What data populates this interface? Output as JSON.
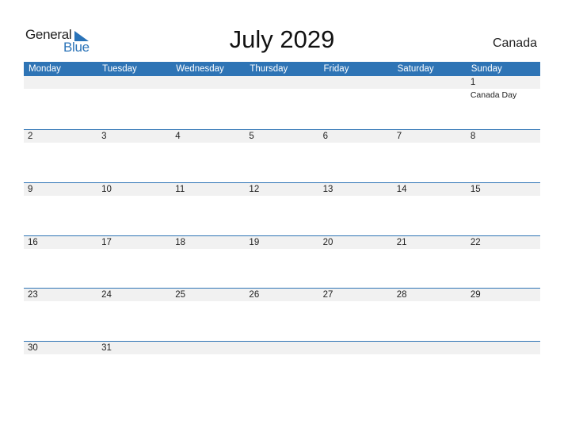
{
  "logo": {
    "general": "General",
    "blue": "Blue",
    "accent": "#2a73b8"
  },
  "title": "July 2029",
  "country": "Canada",
  "header_color": "#2e74b5",
  "weekdays": [
    "Monday",
    "Tuesday",
    "Wednesday",
    "Thursday",
    "Friday",
    "Saturday",
    "Sunday"
  ],
  "weeks": [
    {
      "days": [
        {
          "num": "",
          "event": ""
        },
        {
          "num": "",
          "event": ""
        },
        {
          "num": "",
          "event": ""
        },
        {
          "num": "",
          "event": ""
        },
        {
          "num": "",
          "event": ""
        },
        {
          "num": "",
          "event": ""
        },
        {
          "num": "1",
          "event": "Canada Day"
        }
      ]
    },
    {
      "days": [
        {
          "num": "2"
        },
        {
          "num": "3"
        },
        {
          "num": "4"
        },
        {
          "num": "5"
        },
        {
          "num": "6"
        },
        {
          "num": "7"
        },
        {
          "num": "8"
        }
      ]
    },
    {
      "days": [
        {
          "num": "9"
        },
        {
          "num": "10"
        },
        {
          "num": "11"
        },
        {
          "num": "12"
        },
        {
          "num": "13"
        },
        {
          "num": "14"
        },
        {
          "num": "15"
        }
      ]
    },
    {
      "days": [
        {
          "num": "16"
        },
        {
          "num": "17"
        },
        {
          "num": "18"
        },
        {
          "num": "19"
        },
        {
          "num": "20"
        },
        {
          "num": "21"
        },
        {
          "num": "22"
        }
      ]
    },
    {
      "days": [
        {
          "num": "23"
        },
        {
          "num": "24"
        },
        {
          "num": "25"
        },
        {
          "num": "26"
        },
        {
          "num": "27"
        },
        {
          "num": "28"
        },
        {
          "num": "29"
        }
      ]
    },
    {
      "days": [
        {
          "num": "30"
        },
        {
          "num": "31"
        },
        {
          "num": ""
        },
        {
          "num": ""
        },
        {
          "num": ""
        },
        {
          "num": ""
        },
        {
          "num": ""
        }
      ]
    }
  ]
}
